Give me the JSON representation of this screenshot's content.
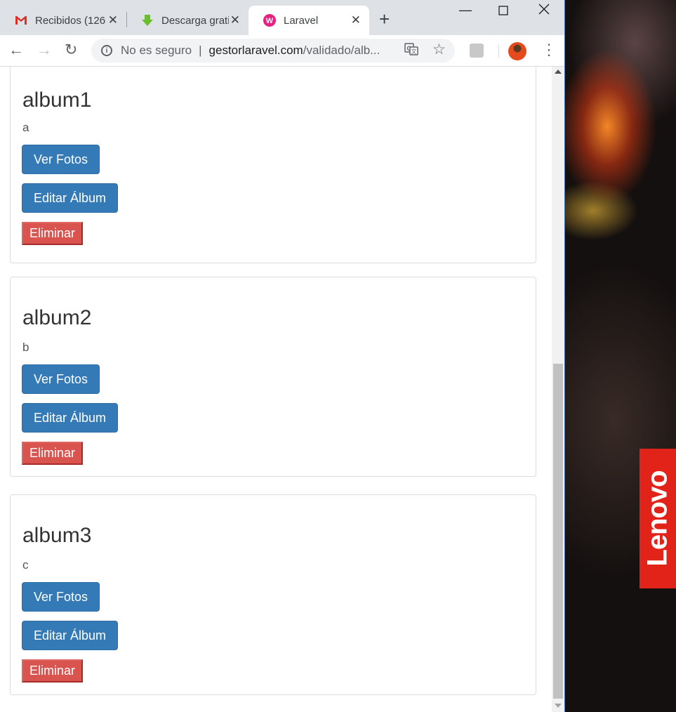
{
  "tabs": [
    {
      "label": "Recibidos (126",
      "icon": "gmail-icon",
      "active": false
    },
    {
      "label": "Descarga grati",
      "icon": "download-arrow-icon",
      "active": false
    },
    {
      "label": "Laravel",
      "icon": "wamp-icon",
      "active": true
    }
  ],
  "omnibox": {
    "security_text": "No es seguro",
    "separator": "|",
    "url_host": "gestorlaravel.com",
    "url_path": "/validado/alb..."
  },
  "albums": [
    {
      "title": "album1",
      "description": "a",
      "view_label": "Ver Fotos",
      "edit_label": "Editar Álbum",
      "delete_label": "Eliminar"
    },
    {
      "title": "album2",
      "description": "b",
      "view_label": "Ver Fotos",
      "edit_label": "Editar Álbum",
      "delete_label": "Eliminar"
    },
    {
      "title": "album3",
      "description": "c",
      "view_label": "Ver Fotos",
      "edit_label": "Editar Álbum",
      "delete_label": "Eliminar"
    }
  ],
  "desktop": {
    "brand_logo": "Lenovo"
  },
  "colors": {
    "primary": "#337ab7",
    "danger": "#d9534f",
    "brand": "#e2231a"
  }
}
